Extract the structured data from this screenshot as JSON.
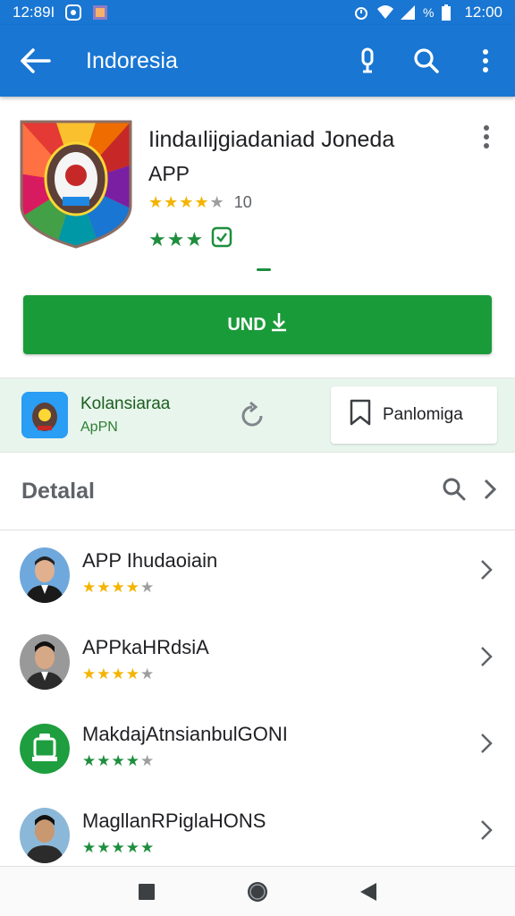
{
  "status_bar": {
    "time_left": "12:89I",
    "time_right": "12:00",
    "battery_text": "%"
  },
  "app_bar": {
    "title": "Indoresia",
    "icons": [
      "back-arrow-icon",
      "mic-icon",
      "search-icon",
      "more-vert-icon"
    ]
  },
  "app": {
    "name": "Iindaılijgiadaniad Joneda",
    "subtitle": "APP",
    "rating_count": "10",
    "rating_stars": 4,
    "green_stars": 3
  },
  "install_button": {
    "label": "UND"
  },
  "promo": {
    "title": "Kolansiaraa",
    "subtitle": "ApPN",
    "button_label": "Panlomiga"
  },
  "section": {
    "title": "Detalal"
  },
  "list": [
    {
      "title": "APP Ihudaoiain",
      "stars": 4,
      "star_color": "#f4b400",
      "avatar": "person-avatar"
    },
    {
      "title": "APPkaHRdsiA",
      "stars": 4,
      "star_color": "#f4b400",
      "avatar": "person-avatar"
    },
    {
      "title": "MakdajAtnsianbulGONI",
      "stars": 4,
      "star_color": "#1e8e3e",
      "avatar": "green-emblem-avatar"
    },
    {
      "title": "MagllanRPiglaHONS",
      "stars": 5,
      "star_color": "#1e8e3e",
      "avatar": "person-avatar"
    }
  ],
  "colors": {
    "primary": "#1976d2",
    "install_green": "#1a9b3a",
    "promo_bg": "#e8f5ec",
    "star_gold": "#f4b400",
    "star_green": "#1e8e3e"
  }
}
